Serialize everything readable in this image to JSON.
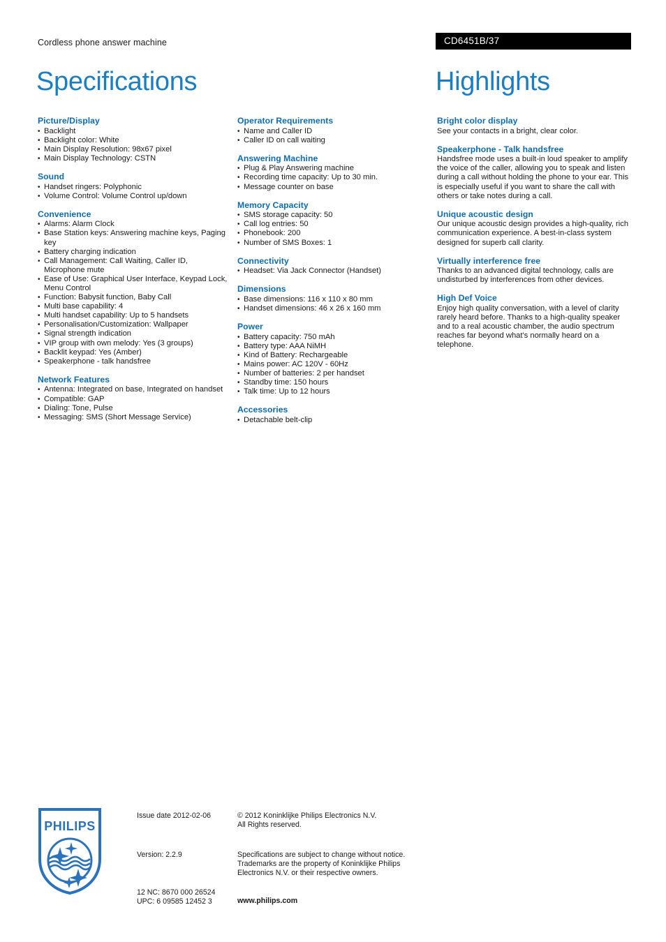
{
  "header": {
    "subtitle": "Cordless phone answer machine",
    "model": "CD6451B/37",
    "title_left": "Specifications",
    "title_right": "Highlights",
    "accent_blue": "#0e6cb4",
    "title_blue": "#1c7ec2",
    "bar_bg": "#000000"
  },
  "spec_columns": [
    {
      "sections": [
        {
          "title": "Picture/Display",
          "items": [
            "Backlight",
            "Backlight color: White",
            "Main Display Resolution: 98x67 pixel",
            "Main Display Technology: CSTN"
          ]
        },
        {
          "title": "Sound",
          "items": [
            "Handset ringers: Polyphonic",
            "Volume Control: Volume Control up/down"
          ]
        },
        {
          "title": "Convenience",
          "items": [
            "Alarms: Alarm Clock",
            "Base Station keys: Answering machine keys, Paging key",
            "Battery charging indication",
            "Call Management: Call Waiting, Caller ID, Microphone mute",
            "Ease of Use: Graphical User Interface, Keypad Lock, Menu Control",
            "Function: Babysit function, Baby Call",
            "Multi base capability: 4",
            "Multi handset capability: Up to 5 handsets",
            "Personalisation/Customization: Wallpaper",
            "Signal strength indication",
            "VIP group with own melody: Yes (3 groups)",
            "Backlit keypad: Yes (Amber)",
            "Speakerphone - talk handsfree"
          ]
        },
        {
          "title": "Network Features",
          "items": [
            "Antenna: Integrated on base, Integrated on handset",
            "Compatible: GAP",
            "Dialing: Tone, Pulse",
            "Messaging: SMS (Short Message Service)"
          ]
        }
      ]
    },
    {
      "sections": [
        {
          "title": "Operator Requirements",
          "items": [
            "Name and Caller ID",
            "Caller ID on call waiting"
          ]
        },
        {
          "title": "Answering Machine",
          "items": [
            "Plug & Play Answering machine",
            "Recording time capacity: Up to 30 min.",
            "Message counter on base"
          ]
        },
        {
          "title": "Memory Capacity",
          "items": [
            "SMS storage capacity: 50",
            "Call log entries: 50",
            "Phonebook: 200",
            "Number of SMS Boxes: 1"
          ]
        },
        {
          "title": "Connectivity",
          "items": [
            "Headset: Via Jack Connector (Handset)"
          ]
        },
        {
          "title": "Dimensions",
          "items": [
            "Base dimensions: 116 x 110 x 80 mm",
            "Handset dimensions: 46 x 26 x 160 mm"
          ]
        },
        {
          "title": "Power",
          "items": [
            "Battery capacity: 750 mAh",
            "Battery type: AAA NiMH",
            "Kind of Battery: Rechargeable",
            "Mains power: AC 120V - 60Hz",
            "Number of batteries: 2 per handset",
            "Standby time: 150 hours",
            "Talk time: Up to 12 hours"
          ]
        },
        {
          "title": "Accessories",
          "items": [
            "Detachable belt-clip"
          ]
        }
      ]
    }
  ],
  "highlights": [
    {
      "title": "Bright color display",
      "body": "See your contacts in a bright, clear color."
    },
    {
      "title": "Speakerphone - Talk handsfree",
      "body": "Handsfree mode uses a built-in loud speaker to amplify the voice of the caller, allowing you to speak and listen during a call without holding the phone to your ear. This is especially useful if you want to share the call with others or take notes during a call."
    },
    {
      "title": "Unique acoustic design",
      "body": "Our unique acoustic design provides a high-quality, rich communication experience. A best-in-class system designed for superb call clarity."
    },
    {
      "title": "Virtually interference free",
      "body": "Thanks to an advanced digital technology, calls are undisturbed by interferences from other devices."
    },
    {
      "title": "High Def Voice",
      "body": "Enjoy high quality conversation, with a level of clarity rarely heard before. Thanks to a high-quality speaker and to a real acoustic chamber, the audio spectrum reaches far beyond what's normally heard on a telephone."
    }
  ],
  "footer": {
    "logo_wordmark": "PHILIPS",
    "issue_date": "Issue date 2012-02-06",
    "version": "Version: 2.2.9",
    "twelve_nc": "12 NC: 8670 000 26524",
    "upc": "UPC: 6 09585 12452 3",
    "copyright_line1": "© 2012 Koninklijke Philips Electronics N.V.",
    "copyright_line2": "All Rights reserved.",
    "disclaimer_line1": "Specifications are subject to change without notice.",
    "disclaimer_line2": "Trademarks are the property of Koninklijke Philips",
    "disclaimer_line3": "Electronics N.V. or their respective owners.",
    "website": "www.philips.com"
  }
}
